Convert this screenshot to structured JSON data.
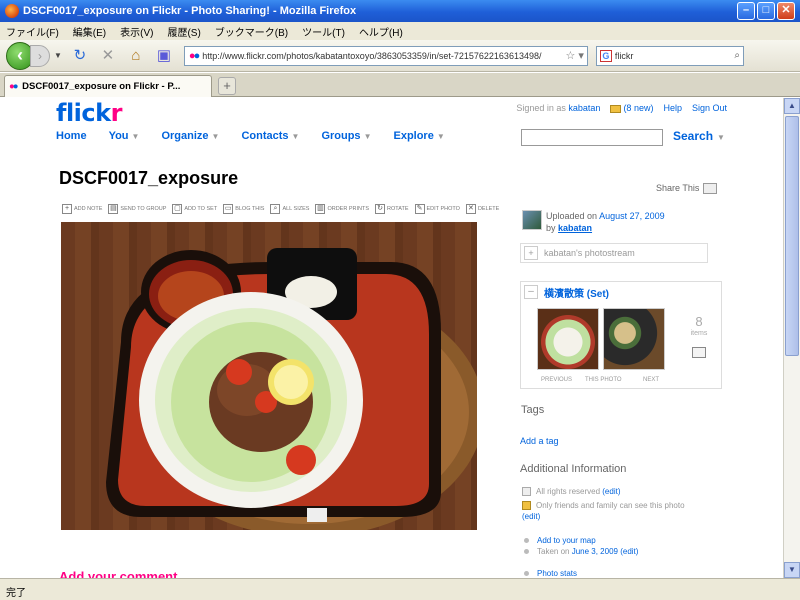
{
  "window": {
    "title": "DSCF0017_exposure on Flickr - Photo Sharing! - Mozilla Firefox"
  },
  "menu": [
    "ファイル(F)",
    "編集(E)",
    "表示(V)",
    "履歴(S)",
    "ブックマーク(B)",
    "ツール(T)",
    "ヘルプ(H)"
  ],
  "address": {
    "url": "http://www.flickr.com/photos/kabatantoxoyo/3863053359/in/set-72157622163613498/"
  },
  "search": {
    "engine_icon": "G",
    "value": "flickr"
  },
  "tab": {
    "title": "DSCF0017_exposure on Flickr - P..."
  },
  "flickr": {
    "logo_part1": "flick",
    "logo_part2": "r",
    "signed_in_as": "Signed in as",
    "username": "kabatan",
    "new_mail": "(8 new)",
    "help": "Help",
    "signout": "Sign Out",
    "nav": [
      "Home",
      "You",
      "Organize",
      "Contacts",
      "Groups",
      "Explore"
    ],
    "search_button": "Search"
  },
  "photo": {
    "title": "DSCF0017_exposure",
    "share": "Share This",
    "actions": [
      "ADD NOTE",
      "SEND TO GROUP",
      "ADD TO SET",
      "BLOG THIS",
      "ALL SIZES",
      "ORDER PRINTS",
      "ROTATE",
      "EDIT PHOTO",
      "DELETE"
    ],
    "add_comment": "Add your comment"
  },
  "sidebar": {
    "uploaded_on": "Uploaded on",
    "upload_date": "August 27, 2009",
    "by": "by",
    "owner": "kabatan",
    "photostream": "kabatan's photostream",
    "set_name": "横濱散策 (Set)",
    "set_count": "8",
    "set_count_label": "items",
    "prev": "PREVIOUS",
    "thumb_mid": "THIS PHOTO",
    "next": "NEXT",
    "tags_heading": "Tags",
    "add_tag": "Add a tag",
    "additional_info": "Additional Information",
    "rights": "All rights reserved",
    "rights_edit": "(edit)",
    "visibility": "Only friends and family can see this photo",
    "visibility_edit": "(edit)",
    "add_to_map": "Add to your map",
    "taken_on_prefix": "Taken on",
    "taken_date": "June 3, 2009",
    "taken_edit": "(edit)",
    "photo_stats": "Photo stats"
  },
  "status": {
    "text": "完了"
  },
  "colors": {
    "flickr_blue": "#0063dc",
    "flickr_pink": "#ff0084",
    "xp_title": "#1f5fd8",
    "xp_chrome": "#ece9d8"
  }
}
